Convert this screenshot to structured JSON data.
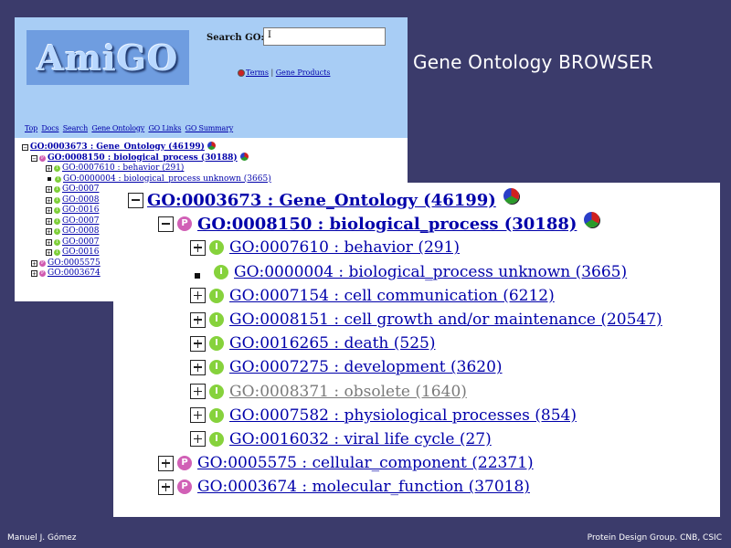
{
  "slide": {
    "title": "Gene Ontology BROWSER",
    "footer_left": "Manuel J. Gómez",
    "footer_right": "Protein Design Group. CNB, CSIC"
  },
  "small_window": {
    "logo_text": "AmiGO",
    "search_label": "Search GO:",
    "search_value": "I",
    "search_options": [
      "Terms",
      "Gene Products"
    ],
    "nav_links": [
      "Top",
      "Docs",
      "Search",
      "Gene Ontology",
      "GO Links",
      "GO Summary"
    ],
    "tree": [
      {
        "toggle": "−",
        "icon": "",
        "text": "GO:0003673 : Gene_Ontology (46199)",
        "bold": true
      },
      {
        "toggle": "−",
        "icon": "P",
        "text": "GO:0008150 : biological_process (30188)",
        "bold": true
      },
      {
        "toggle": "+",
        "icon": "I",
        "text": "GO:0007610 : behavior (291)"
      },
      {
        "toggle": "leaf",
        "icon": "I",
        "text": "GO:0000004 : biological_process unknown (3665)"
      },
      {
        "toggle": "+",
        "icon": "I",
        "text": "GO:0007"
      },
      {
        "toggle": "+",
        "icon": "I",
        "text": "GO:0008"
      },
      {
        "toggle": "+",
        "icon": "I",
        "text": "GO:0016"
      },
      {
        "toggle": "+",
        "icon": "I",
        "text": "GO:0007"
      },
      {
        "toggle": "+",
        "icon": "I",
        "text": "GO:0008"
      },
      {
        "toggle": "+",
        "icon": "I",
        "text": "GO:0007"
      },
      {
        "toggle": "+",
        "icon": "I",
        "text": "GO:0016"
      },
      {
        "toggle": "+",
        "icon": "P",
        "text": "GO:0005575"
      },
      {
        "toggle": "+",
        "icon": "P",
        "text": "GO:0003674"
      }
    ]
  },
  "tree": {
    "root": {
      "id": "GO:0003673",
      "name": "Gene_Ontology",
      "count": "(46199)",
      "label": "GO:0003673 : Gene_Ontology (46199)"
    },
    "bio": {
      "id": "GO:0008150",
      "name": "biological_process",
      "count": "(30188)",
      "icon": "P",
      "label": "GO:0008150 : biological_process (30188)"
    },
    "children": [
      {
        "label": "GO:0007610 : behavior (291)",
        "icon": "I",
        "toggle": "plus"
      },
      {
        "label": "GO:0000004 : biological_process unknown (3665)",
        "icon": "I",
        "toggle": "leaf"
      },
      {
        "label": "GO:0007154 : cell communication (6212)",
        "icon": "I",
        "toggle": "plus"
      },
      {
        "label": "GO:0008151 : cell growth and/or maintenance (20547)",
        "icon": "I",
        "toggle": "plus"
      },
      {
        "label": "GO:0016265 : death (525)",
        "icon": "I",
        "toggle": "plus"
      },
      {
        "label": "GO:0007275 : development (3620)",
        "icon": "I",
        "toggle": "plus"
      },
      {
        "label": "GO:0008371 : obsolete (1640)",
        "icon": "I",
        "toggle": "plus",
        "obsolete": true
      },
      {
        "label": "GO:0007582 : physiological processes (854)",
        "icon": "I",
        "toggle": "plus"
      },
      {
        "label": "GO:0016032 : viral life cycle (27)",
        "icon": "I",
        "toggle": "plus"
      }
    ],
    "siblings": [
      {
        "label": "GO:0005575 : cellular_component (22371)",
        "icon": "P",
        "toggle": "plus"
      },
      {
        "label": "GO:0003674 : molecular_function (37018)",
        "icon": "P",
        "toggle": "plus"
      }
    ]
  },
  "colors": {
    "slide_bg": "#3b3b6b",
    "header_bg": "#a8cdf5",
    "link": "#0000aa",
    "process_icon": "#d160b6",
    "instance_icon": "#86d23c"
  }
}
